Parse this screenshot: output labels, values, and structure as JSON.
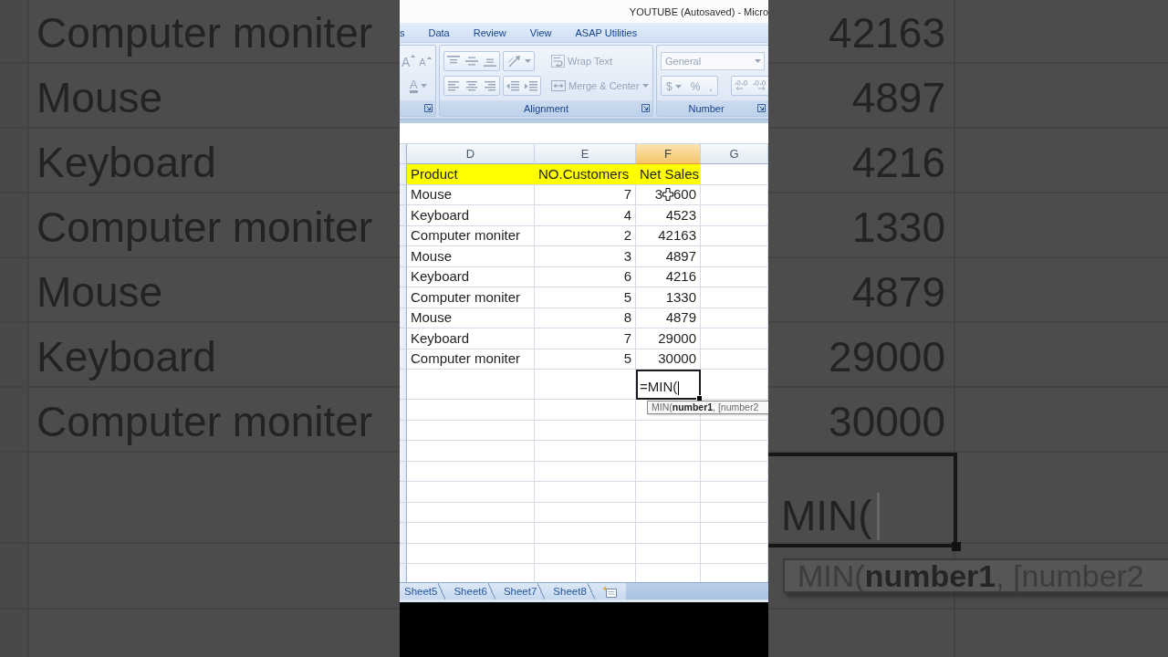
{
  "background_left": {
    "cells": [
      "Computer moniter",
      "Mouse",
      "Keyboard",
      "Computer moniter",
      "Mouse",
      "Keyboard",
      "Computer moniter"
    ]
  },
  "window": {
    "title": "YOUTUBE (Autosaved) - Micro"
  },
  "ribbon": {
    "disabled": true,
    "tabs": [
      {
        "label": "s",
        "selected": false
      },
      {
        "label": "Data",
        "selected": false
      },
      {
        "label": "Review",
        "selected": false
      },
      {
        "label": "View",
        "selected": false
      },
      {
        "label": "ASAP Utilities",
        "selected": false
      }
    ],
    "font_group": {
      "grow_font": "A",
      "shrink_font": "A",
      "font_color": "A"
    },
    "alignment_group": {
      "label": "Alignment",
      "wrap_text": "Wrap Text",
      "merge_center": "Merge & Center"
    },
    "number_group": {
      "label": "Number",
      "format": "General",
      "currency": "$",
      "percent": "%",
      "comma": ","
    }
  },
  "sheet": {
    "columns": [
      {
        "label": "D",
        "selected": false
      },
      {
        "label": "E",
        "selected": false
      },
      {
        "label": "F",
        "selected": true
      },
      {
        "label": "G",
        "selected": false
      }
    ],
    "header": [
      "Product",
      "NO.Customers",
      "Net Sales"
    ],
    "rows": [
      {
        "product": "Mouse",
        "customers": "7",
        "net_sales": [
          "3",
          "600"
        ]
      },
      {
        "product": "Keyboard",
        "customers": "4",
        "net_sales": "4523"
      },
      {
        "product": "Computer moniter",
        "customers": "2",
        "net_sales": "42163"
      },
      {
        "product": "Mouse",
        "customers": "3",
        "net_sales": "4897"
      },
      {
        "product": "Keyboard",
        "customers": "6",
        "net_sales": "4216"
      },
      {
        "product": "Computer moniter",
        "customers": "5",
        "net_sales": "1330"
      },
      {
        "product": "Mouse",
        "customers": "8",
        "net_sales": "4879"
      },
      {
        "product": "Keyboard",
        "customers": "7",
        "net_sales": "29000"
      },
      {
        "product": "Computer moniter",
        "customers": "5",
        "net_sales": "30000"
      }
    ],
    "active_cell": {
      "value": "=MIN("
    },
    "tooltip": "MIN(**number1**, [number2"
  },
  "sheet_tabs": [
    {
      "label": "Sheet5",
      "selected": false
    },
    {
      "label": "Sheet6",
      "selected": false
    },
    {
      "label": "Sheet7",
      "selected": false
    },
    {
      "label": "Sheet8",
      "selected": false
    }
  ],
  "background_right": {
    "cells": [
      "42163",
      "4897",
      "4216",
      "1330",
      "4879",
      "29000",
      "30000"
    ],
    "active_cell": {
      "value": "MIN("
    },
    "tooltip": "MIN(**number1**, [number2"
  }
}
